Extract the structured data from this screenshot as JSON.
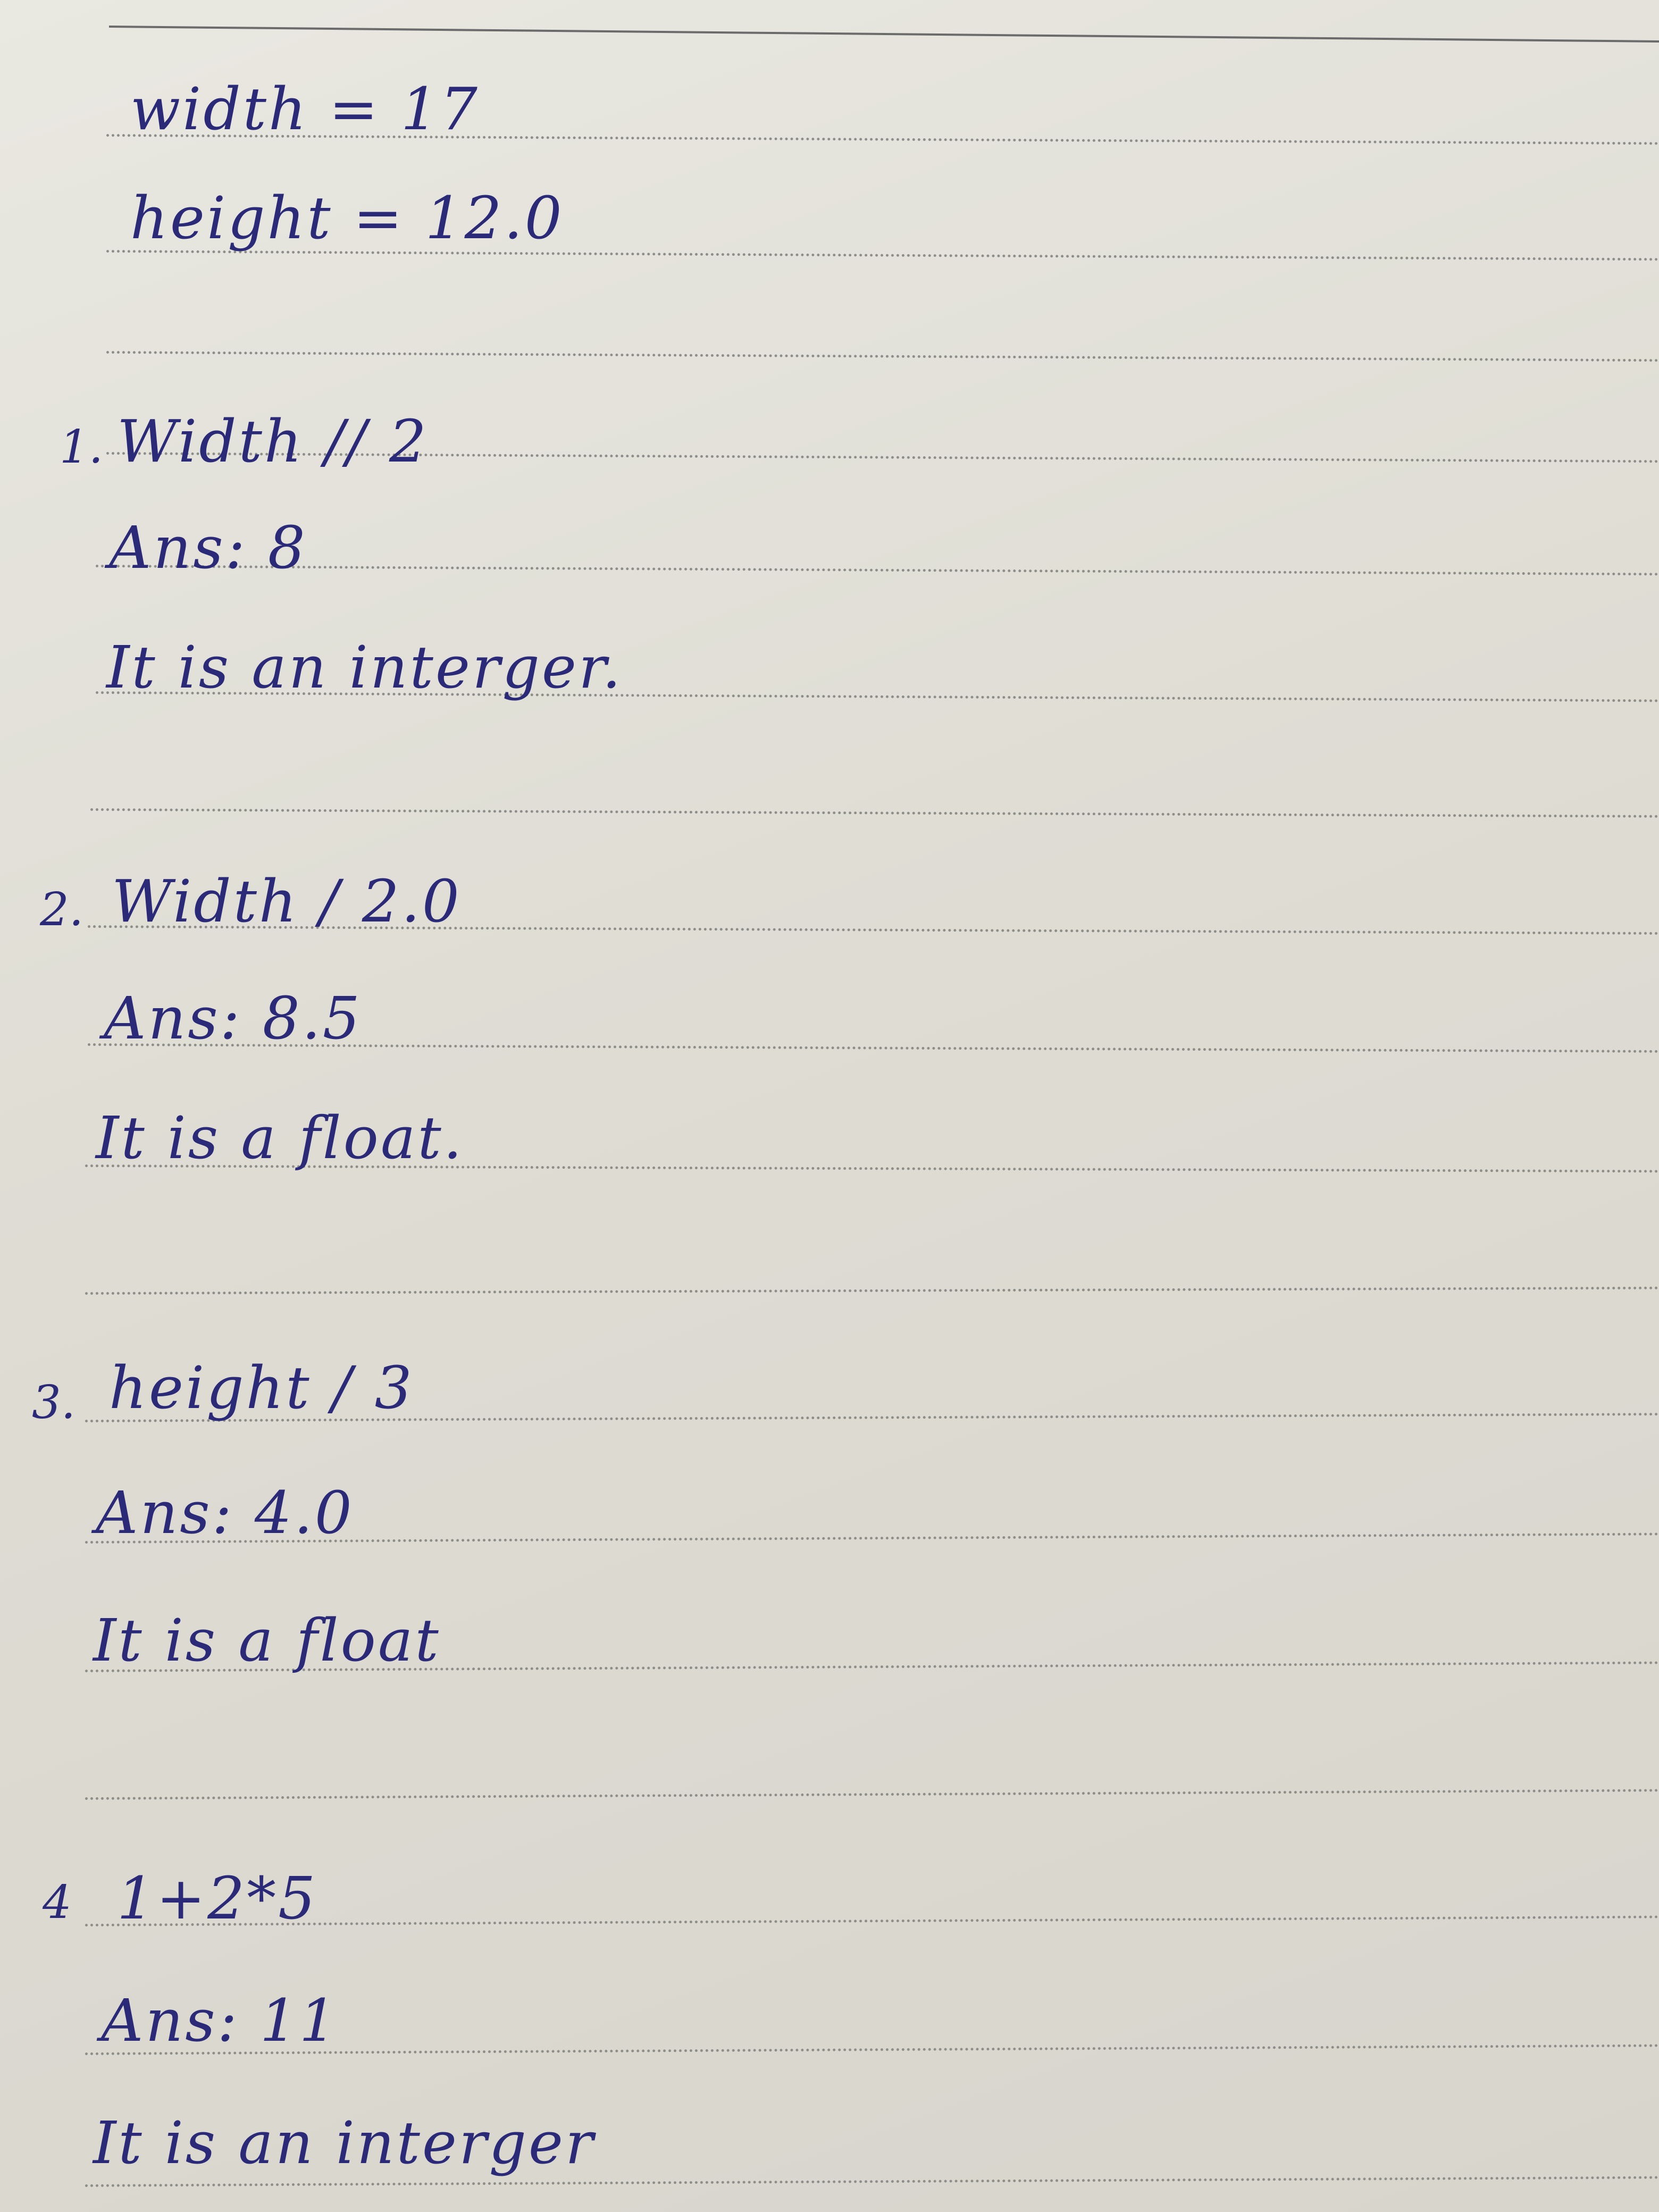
{
  "given": {
    "width_line": "width = 17",
    "height_line": "height = 12.0"
  },
  "questions": [
    {
      "number": "1.",
      "expression": "Width // 2",
      "answer": "Ans: 8",
      "type_note": "It is an interger."
    },
    {
      "number": "2.",
      "expression": "Width / 2.0",
      "answer": "Ans: 8.5",
      "type_note": "It is a float."
    },
    {
      "number": "3.",
      "expression": "height / 3",
      "answer": "Ans: 4.0",
      "type_note": "It is a float"
    },
    {
      "number": "4",
      "expression": "1+2*5",
      "answer": "Ans: 11",
      "type_note": "It is an interger"
    }
  ],
  "colors": {
    "ink": "#2b2a78",
    "paper": "#e3e1d9",
    "rule": "#8d8d8a"
  }
}
